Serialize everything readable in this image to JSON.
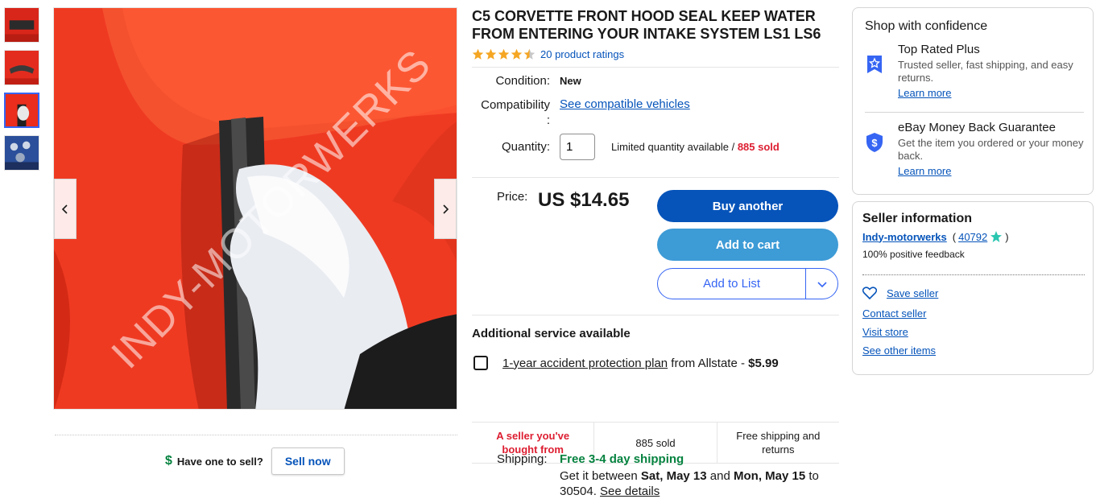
{
  "gallery": {
    "prev_icon": "chevron-left-icon",
    "next_icon": "chevron-right-icon",
    "watermark": "INDY-MOTORWERKS",
    "thumbnails": [
      "thumbnail-1",
      "thumbnail-2",
      "thumbnail-3",
      "thumbnail-4"
    ],
    "active_thumbnail": 3
  },
  "sell": {
    "question": "Have one to sell?",
    "button": "Sell now"
  },
  "listing": {
    "title": "C5 CORVETTE FRONT HOOD SEAL KEEP WATER FROM ENTERING YOUR INTAKE SYSTEM LS1 LS6",
    "rating_stars": 4.5,
    "ratings_link": "20 product ratings",
    "condition_label": "Condition:",
    "condition_value": "New",
    "compat_label": "Compatibility",
    "compat_colon": ":",
    "compat_link": "See compatible vehicles",
    "quantity_label": "Quantity:",
    "quantity_value": "1",
    "limited_text": "Limited quantity available / ",
    "sold_text": "885 sold",
    "price_label": "Price:",
    "price": "US $14.65",
    "buy_button": "Buy another",
    "cart_button": "Add to cart",
    "list_button": "Add to List",
    "additional_title": "Additional service available",
    "plan_link": "1-year accident protection plan",
    "plan_from": " from Allstate - ",
    "plan_price": "$5.99",
    "stats": [
      "A seller you've bought from",
      "885 sold",
      "Free shipping and returns"
    ],
    "shipping_label": "Shipping:",
    "shipping_free": "Free 3-4 day shipping",
    "ship_line_a": "Get it between ",
    "ship_date1": "Sat, May 13",
    "ship_and": " and ",
    "ship_date2": "Mon, May 15",
    "ship_to": " to",
    "ship_zip": "30504. ",
    "ship_details": "See details"
  },
  "confidence": {
    "heading": "Shop with confidence",
    "items": [
      {
        "icon": "top-rated-plus-icon",
        "title": "Top Rated Plus",
        "desc": "Trusted seller, fast shipping, and easy returns.",
        "link": "Learn more"
      },
      {
        "icon": "money-back-icon",
        "title": "eBay Money Back Guarantee",
        "desc": "Get the item you ordered or your money back.",
        "link": "Learn more"
      }
    ]
  },
  "seller": {
    "heading": "Seller information",
    "name": "Indy-motorwerks",
    "score_open": "(",
    "score": "40792",
    "score_close": ")",
    "feedback": "100% positive feedback",
    "save": "Save seller",
    "contact": "Contact seller",
    "store": "Visit store",
    "other": "See other items"
  },
  "colors": {
    "link_blue": "#0654ba",
    "buy_blue": "#0654ba",
    "cart_blue": "#3d9bd6",
    "sold_red": "#dd1e31",
    "ship_green": "#05823f",
    "star_gold": "#f5a623"
  }
}
